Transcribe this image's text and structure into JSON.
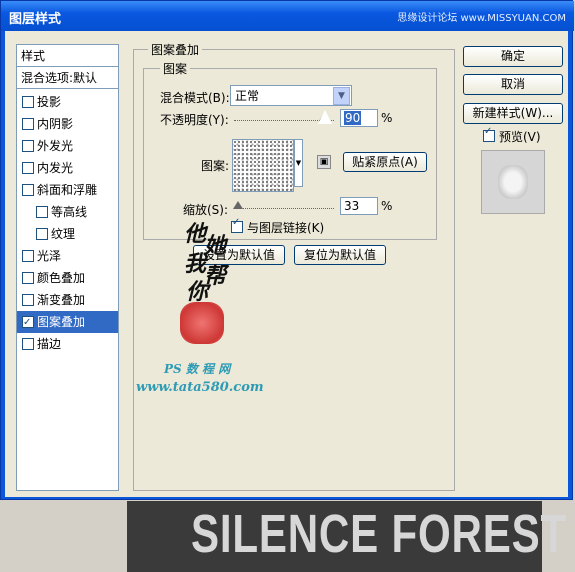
{
  "window": {
    "title": "图层样式",
    "watermark": "思缘设计论坛 www.MISSYUAN.COM"
  },
  "sidebar": {
    "header": "样式",
    "blend_options": "混合选项:默认",
    "items": [
      {
        "label": "投影",
        "checked": false
      },
      {
        "label": "内阴影",
        "checked": false
      },
      {
        "label": "外发光",
        "checked": false
      },
      {
        "label": "内发光",
        "checked": false
      },
      {
        "label": "斜面和浮雕",
        "checked": false
      },
      {
        "label": "等高线",
        "checked": false
      },
      {
        "label": "纹理",
        "checked": false
      },
      {
        "label": "光泽",
        "checked": false
      },
      {
        "label": "颜色叠加",
        "checked": false
      },
      {
        "label": "渐变叠加",
        "checked": false
      },
      {
        "label": "图案叠加",
        "checked": true,
        "selected": true
      },
      {
        "label": "描边",
        "checked": false
      }
    ]
  },
  "panel": {
    "group_title": "图案叠加",
    "subgroup_title": "图案",
    "blend_mode_label": "混合模式(B):",
    "blend_mode_value": "正常",
    "opacity_label": "不透明度(Y):",
    "opacity_value": "90",
    "opacity_unit": "%",
    "opacity_level": 0.9,
    "pattern_label": "图案:",
    "snap_button": "贴紧原点(A)",
    "scale_label": "缩放(S):",
    "scale_value": "33",
    "scale_unit": "%",
    "scale_level": 0.33,
    "link_label": "与图层链接(K)",
    "link_checked": true,
    "make_default": "设置为默认值",
    "reset_default": "复位为默认值"
  },
  "actions": {
    "ok": "确定",
    "cancel": "取消",
    "new_style": "新建样式(W)...",
    "preview_label": "预览(V)",
    "preview_checked": true
  },
  "watermark": {
    "calligraphy": [
      "他",
      "她",
      "我",
      "帮",
      "你"
    ],
    "ps_text": "PS 数 程 网",
    "url": "www.tata580.com"
  },
  "canvas": {
    "text": "SILENCE FOREST"
  }
}
